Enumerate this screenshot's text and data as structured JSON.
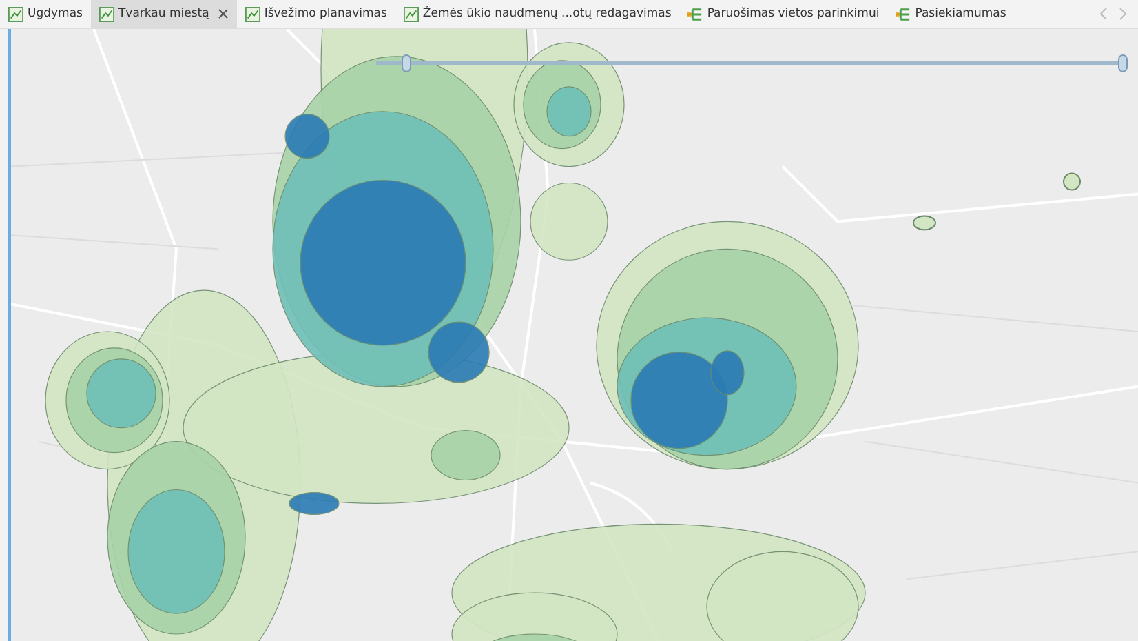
{
  "tabs": [
    {
      "label": "Ugdymas",
      "selected": false,
      "kind": "map"
    },
    {
      "label": "Tvarkau miestą",
      "selected": true,
      "kind": "map"
    },
    {
      "label": "Išvežimo planavimas",
      "selected": false,
      "kind": "map"
    },
    {
      "label": "Žemės ūkio naudmenų ...otų redagavimas",
      "selected": false,
      "kind": "map"
    },
    {
      "label": "Paruošimas vietos parinkimui",
      "selected": false,
      "kind": "layout"
    },
    {
      "label": "Pasiekiamumas",
      "selected": false,
      "kind": "layout"
    }
  ]
}
